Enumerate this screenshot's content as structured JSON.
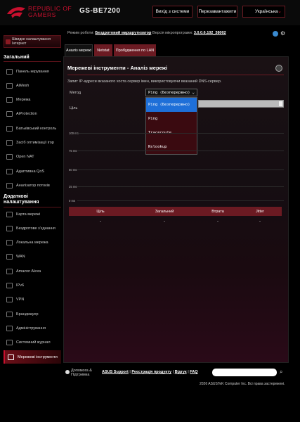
{
  "header": {
    "brand_line1": "REPUBLIC OF",
    "brand_line2": "GAMERS",
    "model": "GS-BE7200",
    "logout_label": "Вихід з системи",
    "reboot_label": "Перезавантажити",
    "language": "Українська",
    "accent_color": "#c8102e"
  },
  "status": {
    "mode_label": "Режим роботи:",
    "mode_value": "Бездротовий маршрутизатор",
    "firmware_label": "Версія мікропрограми:",
    "firmware_value": "3.0.0.6.102_38002"
  },
  "sidebar": {
    "qis_label": "Швидке налаштування Інтернет",
    "general_title": "Загальний",
    "general_items": [
      {
        "label": "Панель керування",
        "icon": "dashboard-icon"
      },
      {
        "label": "AiMesh",
        "icon": "aimesh-icon"
      },
      {
        "label": "Мережа",
        "icon": "network-icon"
      },
      {
        "label": "AiProtection",
        "icon": "shield-icon"
      },
      {
        "label": "Батьківський контроль",
        "icon": "parental-icon"
      },
      {
        "label": "Засіб оптимізації ігор",
        "icon": "game-icon"
      },
      {
        "label": "Open NAT",
        "icon": "open-nat-icon"
      },
      {
        "label": "Адаптивна QoS",
        "icon": "qos-icon"
      },
      {
        "label": "Аналізатор потоків",
        "icon": "traffic-icon"
      }
    ],
    "advanced_title": "Додаткові налаштування",
    "advanced_items": [
      {
        "label": "Карта мережі",
        "icon": "network-map-icon"
      },
      {
        "label": "Бездротове з'єднання",
        "icon": "wireless-icon"
      },
      {
        "label": "Локальна мережа",
        "icon": "lan-icon"
      },
      {
        "label": "WAN",
        "icon": "wan-icon"
      },
      {
        "label": "Amazon Alexa",
        "icon": "alexa-icon"
      },
      {
        "label": "IPv6",
        "icon": "ipv6-icon"
      },
      {
        "label": "VPN",
        "icon": "vpn-icon"
      },
      {
        "label": "Брандмауер",
        "icon": "firewall-icon"
      },
      {
        "label": "Адміністрування",
        "icon": "admin-icon"
      },
      {
        "label": "Системний журнал",
        "icon": "log-icon"
      },
      {
        "label": "Мережеві інструменти",
        "icon": "tools-icon"
      }
    ]
  },
  "tabs": [
    {
      "label": "Аналіз мережі",
      "active": true
    },
    {
      "label": "Netstat",
      "active": false
    },
    {
      "label": "Пробудження по LAN",
      "active": false
    }
  ],
  "panel": {
    "title": "Мережеві інструменти - Аналіз мережі",
    "description": "Запит IP-адреси вказаного хоста сервер імен, використовуючи вказаний DNS-сервер.",
    "method_label": "Метод",
    "target_label": "Ціль",
    "method_value": "Ping (Безперервно)",
    "method_options": [
      "Ping (Безперервно)",
      "Ping",
      "Traceroute",
      "Nslookup"
    ],
    "chart_y_labels": [
      "100 ms",
      "75 ms",
      "50 ms",
      "25 ms",
      "0 ms"
    ],
    "table_headers": [
      "Ціль",
      "Загальний",
      "Втрата",
      "Jitter"
    ],
    "table_row": [
      "-",
      "-",
      "-",
      "-"
    ]
  },
  "footer": {
    "help_line1": "Допомога &",
    "help_line2": "Підтримка",
    "link_support": "ASUS Support",
    "link_register": "Реєстрація продукту",
    "link_feedback": "Відгук",
    "link_faq": "FAQ",
    "separator": " | ",
    "copyright": "2026 ASUSTeK Computer Inc. Всі права застережені."
  }
}
